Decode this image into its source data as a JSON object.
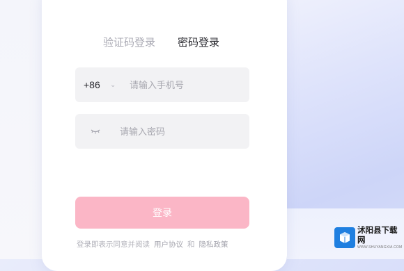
{
  "tabs": [
    {
      "label": "验证码登录",
      "active": false
    },
    {
      "label": "密码登录",
      "active": true
    }
  ],
  "phone_field": {
    "country_code": "+86",
    "value": "",
    "placeholder": "请输入手机号"
  },
  "password_field": {
    "value": "",
    "placeholder": "请输入密码"
  },
  "login_button": {
    "label": "登录"
  },
  "agreement": {
    "prefix": "登录即表示同意并阅读",
    "user_terms": "用户协议",
    "connector": "和",
    "privacy_policy": "隐私政策"
  },
  "watermark": {
    "title": "沭阳县下载网",
    "subtitle": "WWW.SHUYANGXIA.COM"
  },
  "colors": {
    "login_button": "#fbb6c6",
    "active_tab": "#26262c",
    "inactive_tab": "#a9a9b3",
    "watermark_logo": "#1f7fe0"
  },
  "icons": {
    "country_dropdown": "chevron-down-icon",
    "password_toggle": "eye-closed-icon",
    "watermark_logo": "box-icon"
  }
}
